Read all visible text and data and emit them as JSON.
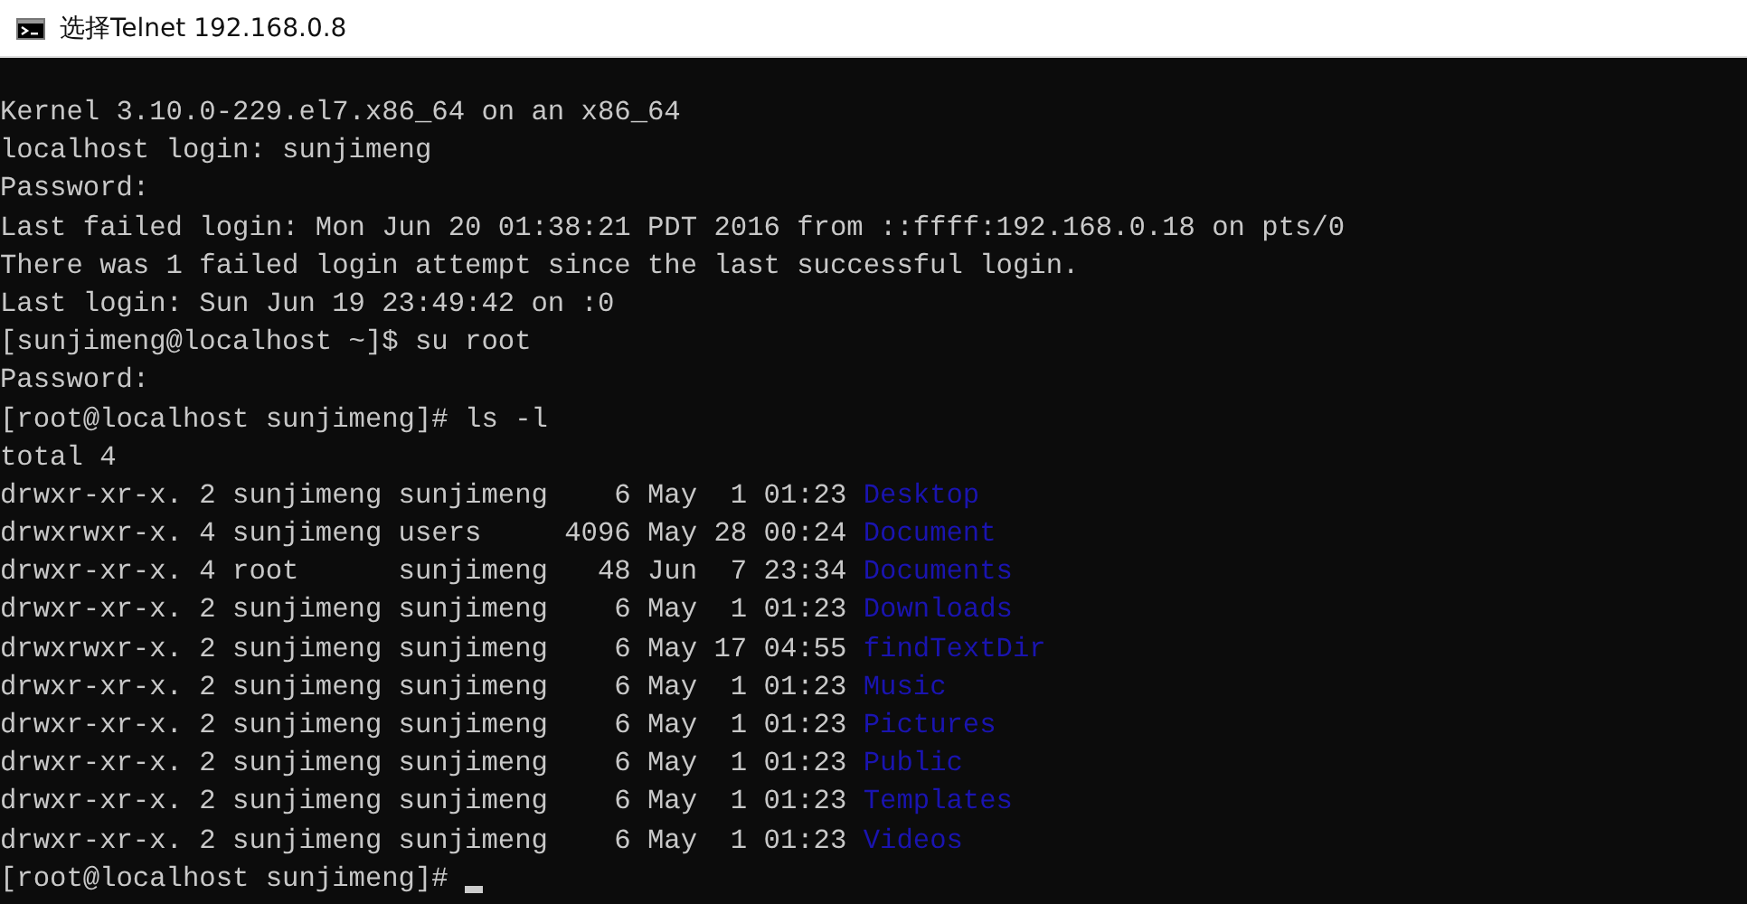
{
  "window": {
    "title": "选择Telnet 192.168.0.8"
  },
  "lines": [
    {
      "kind": "text",
      "text": "Kernel 3.10.0-229.el7.x86_64 on an x86_64"
    },
    {
      "kind": "text",
      "text": "localhost login: sunjimeng"
    },
    {
      "kind": "text",
      "text": "Password:"
    },
    {
      "kind": "text",
      "text": "Last failed login: Mon Jun 20 01:38:21 PDT 2016 from ::ffff:192.168.0.18 on pts/0"
    },
    {
      "kind": "text",
      "text": "There was 1 failed login attempt since the last successful login."
    },
    {
      "kind": "text",
      "text": "Last login: Sun Jun 19 23:49:42 on :0"
    },
    {
      "kind": "text",
      "text": "[sunjimeng@localhost ~]$ su root"
    },
    {
      "kind": "text",
      "text": "Password:"
    },
    {
      "kind": "text",
      "text": "[root@localhost sunjimeng]# ls -l"
    },
    {
      "kind": "text",
      "text": "total 4"
    },
    {
      "kind": "entry",
      "info": "drwxr-xr-x. 2 sunjimeng sunjimeng    6 May  1 01:23",
      "name": "Desktop"
    },
    {
      "kind": "entry",
      "info": "drwxrwxr-x. 4 sunjimeng users     4096 May 28 00:24",
      "name": "Document"
    },
    {
      "kind": "entry",
      "info": "drwxr-xr-x. 4 root      sunjimeng   48 Jun  7 23:34",
      "name": "Documents"
    },
    {
      "kind": "entry",
      "info": "drwxr-xr-x. 2 sunjimeng sunjimeng    6 May  1 01:23",
      "name": "Downloads"
    },
    {
      "kind": "entry",
      "info": "drwxrwxr-x. 2 sunjimeng sunjimeng    6 May 17 04:55",
      "name": "findTextDir"
    },
    {
      "kind": "entry",
      "info": "drwxr-xr-x. 2 sunjimeng sunjimeng    6 May  1 01:23",
      "name": "Music"
    },
    {
      "kind": "entry",
      "info": "drwxr-xr-x. 2 sunjimeng sunjimeng    6 May  1 01:23",
      "name": "Pictures"
    },
    {
      "kind": "entry",
      "info": "drwxr-xr-x. 2 sunjimeng sunjimeng    6 May  1 01:23",
      "name": "Public"
    },
    {
      "kind": "entry",
      "info": "drwxr-xr-x. 2 sunjimeng sunjimeng    6 May  1 01:23",
      "name": "Templates"
    },
    {
      "kind": "entry",
      "info": "drwxr-xr-x. 2 sunjimeng sunjimeng    6 May  1 01:23",
      "name": "Videos"
    },
    {
      "kind": "prompt",
      "text": "[root@localhost sunjimeng]#"
    }
  ]
}
